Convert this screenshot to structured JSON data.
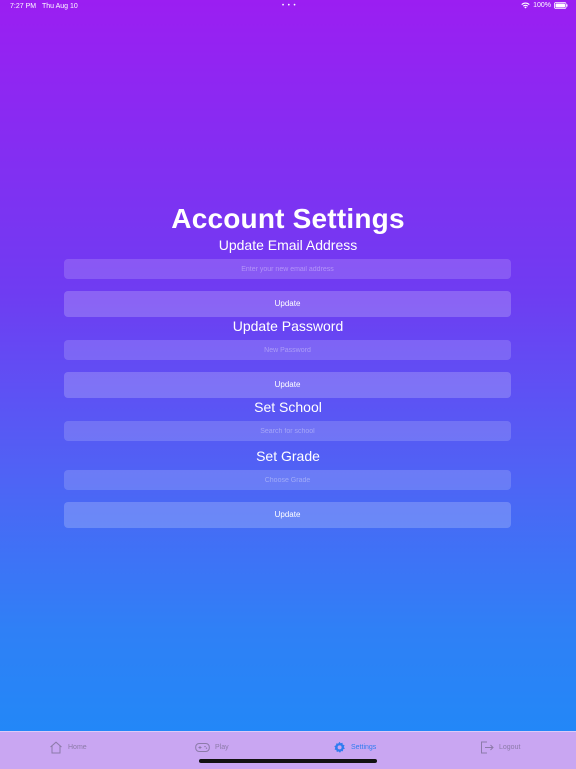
{
  "status_bar": {
    "time": "7:27 PM",
    "date": "Thu Aug 10",
    "dots": "• • •",
    "battery": "100%"
  },
  "page": {
    "title": "Account Settings"
  },
  "email_section": {
    "label": "Update Email Address",
    "placeholder": "Enter your new email address",
    "button": "Update"
  },
  "password_section": {
    "label": "Update Password",
    "placeholder": "New Password",
    "button": "Update"
  },
  "school_section": {
    "label": "Set School",
    "placeholder": "Search for school"
  },
  "grade_section": {
    "label": "Set Grade",
    "placeholder": "Choose Grade",
    "button": "Update"
  },
  "tab_bar": {
    "items": [
      {
        "label": "Home",
        "icon": "home-icon"
      },
      {
        "label": "Play",
        "icon": "gamepad-icon"
      },
      {
        "label": "Settings",
        "icon": "gear-icon"
      },
      {
        "label": "Logout",
        "icon": "logout-icon"
      }
    ],
    "active_color": "#2f7cf0",
    "inactive_color": "#8c7aa9"
  }
}
